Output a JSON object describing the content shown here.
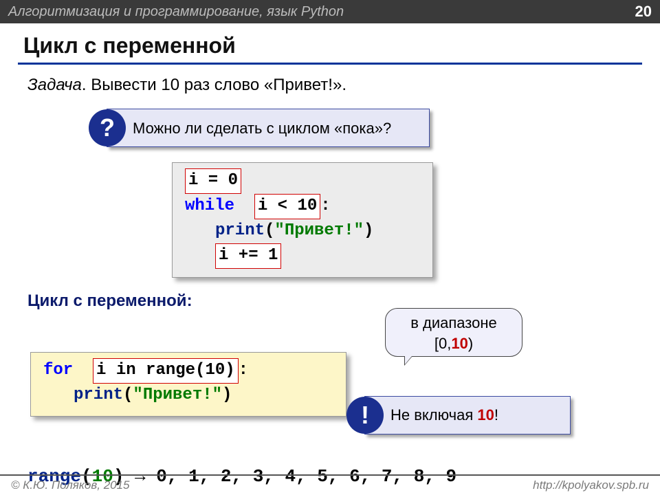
{
  "header": {
    "title": "Алгоритмизация и программирование, язык Python",
    "page_number": "20"
  },
  "title": "Цикл с переменной",
  "task": {
    "label": "Задача",
    "text": ". Вывести 10 раз слово «Привет!»."
  },
  "question": {
    "badge": "?",
    "text": "Можно ли сделать с циклом «пока»?"
  },
  "code_while": {
    "l1": "i = 0",
    "l2_kw": "while",
    "l2_cond": "i < 10",
    "l2_colon": ":",
    "l3_fn": "print",
    "l3_open": "(",
    "l3_str": "\"Привет!\"",
    "l3_close": ")",
    "l4": "i += 1"
  },
  "section_for": "Цикл с переменной:",
  "speech": {
    "line1": "в диапазоне",
    "line2_open": "[0,",
    "line2_val": "10",
    "line2_close": ")"
  },
  "code_for": {
    "l1_kw": "for",
    "l1_body": "i in range(10)",
    "l1_colon": ":",
    "l2_fn": "print",
    "l2_open": "(",
    "l2_str": "\"Привет!\"",
    "l2_close": ")"
  },
  "note": {
    "badge": "!",
    "text_a": "Не включая ",
    "text_b": "10",
    "text_c": "!"
  },
  "range_line": {
    "fn": "range",
    "open": "(",
    "arg": "10",
    "close": ")",
    "arrow": " → ",
    "seq": "0, 1, 2, 3, 4, 5, 6, 7, 8, 9"
  },
  "footer": {
    "left": "© К.Ю. Поляков, 2015",
    "right": "http://kpolyakov.spb.ru"
  }
}
